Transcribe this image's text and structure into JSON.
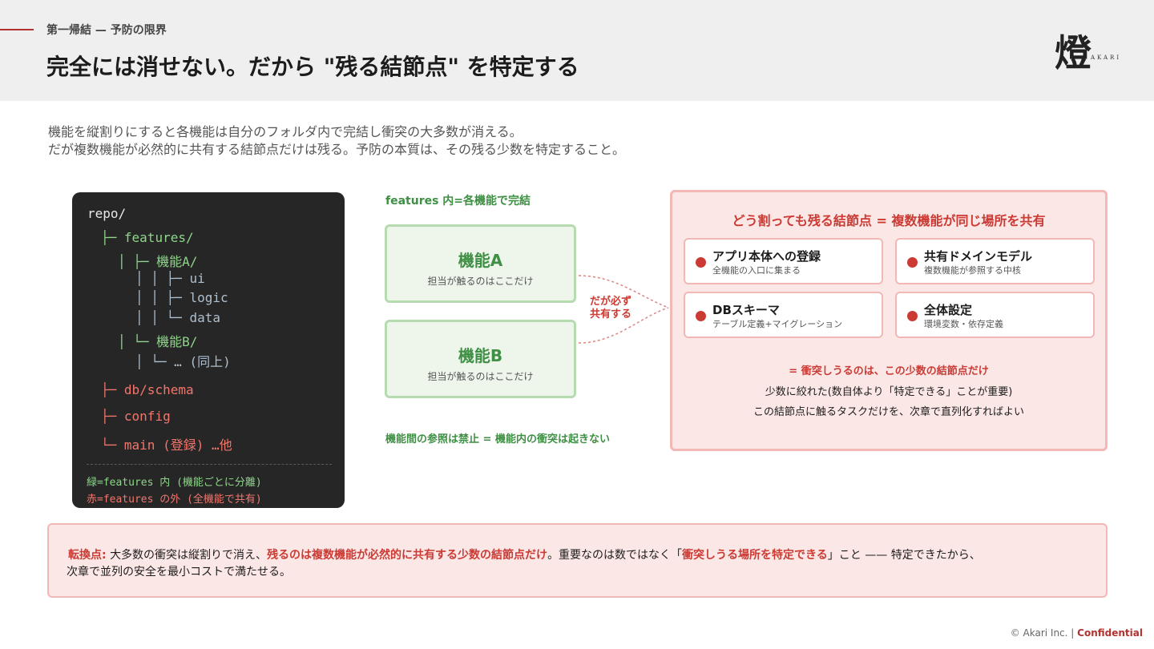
{
  "header": {
    "kicker": "第一帰結 — 予防の限界",
    "title": "完全には消せない。だから \"残る結節点\" を特定する",
    "logo_kanji": "燈",
    "logo_text": "AKARI"
  },
  "lead": {
    "line1": "機能を縦割りにすると各機能は自分のフォルダ内で完結し衝突の大多数が消える。",
    "line2": "だが複数機能が必然的に共有する結節点だけは残る。予防の本質は、その残る少数を特定すること。"
  },
  "tree": {
    "lines": [
      {
        "prefix": "",
        "text": "repo/",
        "color": "white"
      },
      {
        "prefix": "├─ ",
        "text": "features/",
        "color": "green"
      },
      {
        "prefix": "│ ├─ ",
        "text": "機能A/",
        "color": "green"
      },
      {
        "prefix": "│ │ ├─ ",
        "text": "ui",
        "color": "blue"
      },
      {
        "prefix": "│ │ ├─ ",
        "text": "logic",
        "color": "blue"
      },
      {
        "prefix": "│ │ └─ ",
        "text": "data",
        "color": "blue"
      },
      {
        "prefix": "│ └─ ",
        "text": "機能B/",
        "color": "green"
      },
      {
        "prefix": "│ └─ ",
        "text": "… (同上)",
        "color": "blue"
      },
      {
        "prefix": "├─ ",
        "text": "db/schema",
        "color": "red"
      },
      {
        "prefix": "├─ ",
        "text": "config",
        "color": "red"
      },
      {
        "prefix": "└─ ",
        "text": "main (登録) …他",
        "color": "red"
      }
    ],
    "legend_green": "緑=features 内 (機能ごとに分離)",
    "legend_red": "赤=features の外 (全機能で共有)"
  },
  "features": {
    "heading": "features 内=各機能で完結",
    "box_a": {
      "name": "機能A",
      "sub": "担当が触るのはここだけ"
    },
    "box_b": {
      "name": "機能B",
      "sub": "担当が触るのはここだけ"
    },
    "footer": "機能間の参照は禁止 = 機能内の衝突は起きない",
    "connector_line1": "だが必ず",
    "connector_line2": "共有する"
  },
  "panel": {
    "title": "どう割っても残る結節点 = 複数機能が同じ場所を共有",
    "cards": [
      {
        "title": "アプリ本体への登録",
        "sub": "全機能の入口に集まる"
      },
      {
        "title": "共有ドメインモデル",
        "sub": "複数機能が参照する中核"
      },
      {
        "title": "DBスキーマ",
        "sub": "テーブル定義+マイグレーション"
      },
      {
        "title": "全体設定",
        "sub": "環境変数・依存定義"
      }
    ],
    "emphasis": "= 衝突しうるのは、この少数の結節点だけ",
    "line1": "少数に絞れた(数自体より「特定できる」ことが重要)",
    "line2": "この結節点に触るタスクだけを、次章で直列化すればよい"
  },
  "pivot": {
    "label": "転換点:",
    "text1": "大多数の衝突は縦割りで消え、",
    "em1": "残るのは複数機能が必然的に共有する少数の結節点だけ",
    "text2": "。重要なのは数ではなく「",
    "em2": "衝突しうる場所を特定できる",
    "text3": "」こと —— 特定できたから、",
    "line2": "次章で並列の安全を最小コストで満たせる。"
  },
  "footer": {
    "copyright": "© Akari Inc. |",
    "confidential": "Confidential"
  },
  "colors": {
    "accent_red": "#cc3a34",
    "accent_green": "#3f8f45",
    "panel_bg": "#fbe7e6",
    "tree_bg": "#262626"
  }
}
